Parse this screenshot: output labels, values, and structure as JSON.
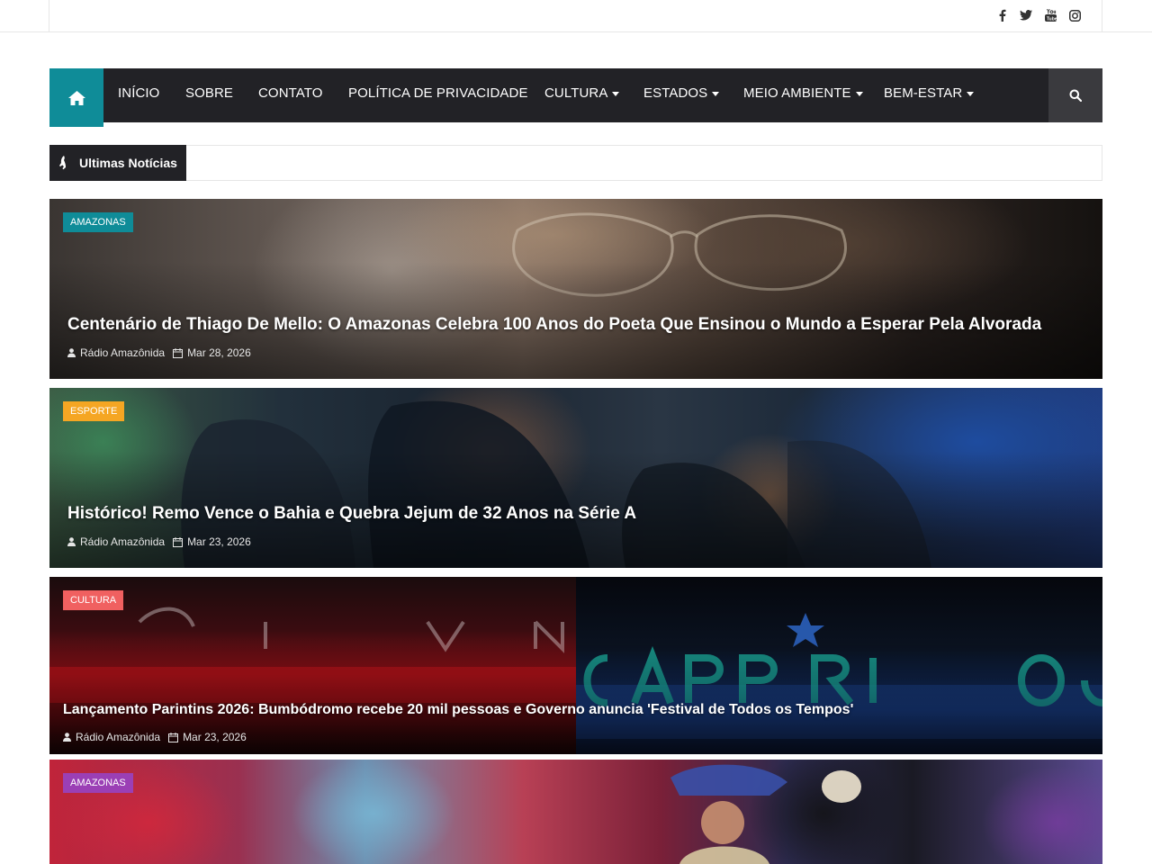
{
  "social": {
    "facebook": "facebook-icon",
    "twitter": "twitter-icon",
    "youtube": "youtube-icon",
    "instagram": "instagram-icon"
  },
  "nav": {
    "home_icon": "home-icon",
    "items": [
      {
        "label": "INÍCIO",
        "dropdown": false
      },
      {
        "label": "SOBRE",
        "dropdown": false
      },
      {
        "label": "CONTATO",
        "dropdown": false
      },
      {
        "label": "POLÍTICA DE PRIVACIDADE",
        "dropdown": false
      },
      {
        "label": "CULTURA",
        "dropdown": true
      },
      {
        "label": "ESTADOS",
        "dropdown": true
      },
      {
        "label": "MEIO AMBIENTE",
        "dropdown": true
      },
      {
        "label": "BEM-ESTAR",
        "dropdown": true
      }
    ],
    "search_icon": "search-icon",
    "accent": "#0f8c98"
  },
  "ticker": {
    "label": "Ultimas Notícias"
  },
  "posts": [
    {
      "category": "AMAZONAS",
      "category_color": "#0f8c98",
      "title": "Centenário de Thiago De Mello: O Amazonas Celebra 100 Anos do Poeta Que Ensinou o Mundo a Esperar Pela Alvorada",
      "author": "Rádio Amazônida",
      "date": "Mar 28, 2026"
    },
    {
      "category": "ESPORTE",
      "category_color": "#f5a623",
      "title": "Histórico! Remo Vence o Bahia e Quebra Jejum de 32 Anos na Série A",
      "author": "Rádio Amazônida",
      "date": "Mar 23, 2026"
    },
    {
      "category": "CULTURA",
      "category_color": "#f06060",
      "title": "Lançamento Parintins 2026: Bumbódromo recebe 20 mil pessoas e Governo anuncia 'Festival de Todos os Tempos'",
      "author": "Rádio Amazônida",
      "date": "Mar 23, 2026"
    },
    {
      "category": "AMAZONAS",
      "category_color": "#9b3fb5",
      "title": "",
      "author": "",
      "date": ""
    }
  ]
}
